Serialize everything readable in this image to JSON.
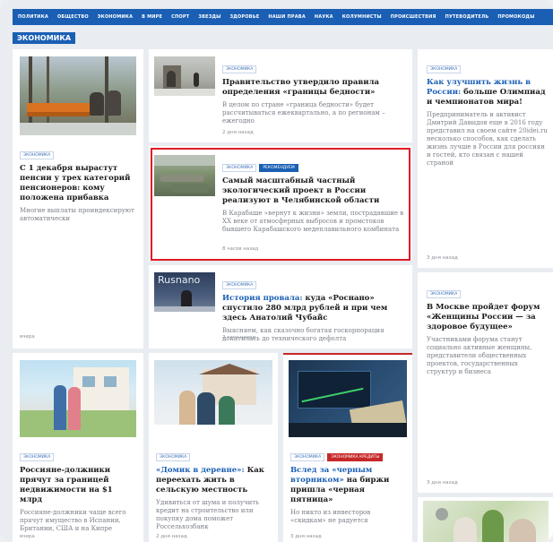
{
  "nav": [
    "ПОЛИТИКА",
    "ОБЩЕСТВО",
    "ЭКОНОМИКА",
    "В МИРЕ",
    "СПОРТ",
    "ЗВЕЗДЫ",
    "ЗДОРОВЬЕ",
    "НАШИ ПРАВА",
    "НАУКА",
    "КОЛУМНИСТЫ",
    "ПРОИСШЕСТВИЯ",
    "ПУТЕВОДИТЕЛЬ",
    "ПРОМОКОДЫ"
  ],
  "section": "ЭКОНОМИКА",
  "tag_econ": "ЭКОНОМИКА",
  "tag_recommend": "РЕКОМЕНДУЕМ",
  "tag_black_friday": "ЭКОНОМИКА КРЕДИТЫ",
  "articles": {
    "pension": {
      "title": "С 1 декабря вырастут пенсии у трех категорий пенсионеров: кому положена прибавка",
      "desc": "Многие выплаты проиндексируют автоматически",
      "time": "вчера"
    },
    "poverty": {
      "title": "Правительство утвердило правила определения «границы бедности»",
      "desc": "В целом по стране «граница бедности» будет рассчитываться ежеквартально, а по регионам – ежегодно",
      "time": "2 дня назад"
    },
    "olympiad": {
      "title_hl": "Как улучшить жизнь в России:",
      "title": " больше Олимпиад и чемпионатов мира!",
      "desc": "Предприниматель и активист Дмитрий Давыдов еще в 2016 году представил на своем сайте 20idei.ru несколько способов, как сделать жизнь лучше в России для россиян и гостей, кто связан с нашей страной",
      "time": "3 дня назад"
    },
    "eco": {
      "title": "Самый масштабный частный экологический проект в России реализуют в Челябинской области",
      "desc": "В Карабаше «вернут к жизни» земли, пострадавшие в XX веке от атмосферных выбросов и промстоков бывшего Карабашского медеплавильного комбината",
      "time": "8 часов назад"
    },
    "rosnano": {
      "title_hl": "История провала:",
      "title": " куда «Роснано» спустило 280 млрд рублей и при чем здесь Анатолий Чубайс",
      "desc": "Выясняем, как сказочно богатая госкорпорация докатилась до технического дефолта",
      "time": "2 часа назад"
    },
    "forum": {
      "title": "В Москве пройдет форум «Женщины России — за здоровое будущее»",
      "desc": "Участниками форума станут социально активные женщины, представители общественных проектов, государственных структур и бизнеса",
      "time": "3 дня назад"
    },
    "debtors": {
      "title": "Россияне-должники прячут за границей недвижимости на $1 млрд",
      "desc": "Россияне-должники чаще всего прячут имущество в Испании, Британии, США и на Кипре",
      "time": "вчера"
    },
    "village": {
      "title_hl": "«Домик в деревне»:",
      "title": " Как переехать жить в сельскую местность",
      "desc": "Удивиться от шума и получить кредит на строительство или покупку дома поможет Россельхозбанк",
      "time": "2 дня назад"
    },
    "blackfriday": {
      "title_hl": "Вслед за «черным вторником»",
      "title": " на биржи пришла «черная пятница»",
      "desc": "Но никто из инвесторов «скидкам» не радуется",
      "time": "3 дня назад"
    }
  },
  "rosnano_sign": "Rusnano"
}
